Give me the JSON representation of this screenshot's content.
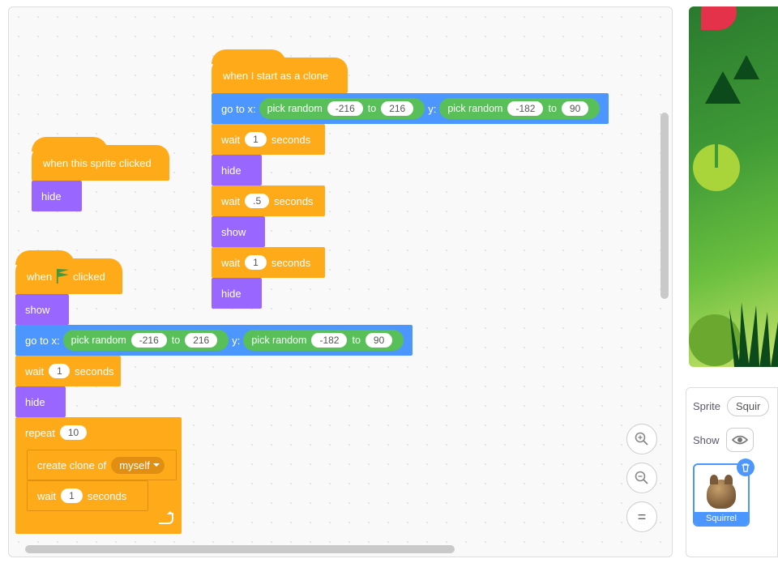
{
  "stack1": {
    "hat": "when this sprite clicked",
    "hide": "hide"
  },
  "stack2": {
    "hat_prefix": "when",
    "hat_suffix": "clicked",
    "show": "show",
    "goto_prefix": "go to x:",
    "goto_y": "y:",
    "pick": "pick random",
    "to": "to",
    "x_min": "-216",
    "x_max": "216",
    "y_min": "-182",
    "y_max": "90",
    "wait": "wait",
    "seconds": "seconds",
    "wait1_val": "1",
    "hide": "hide",
    "repeat": "repeat",
    "repeat_val": "10",
    "clone": "create clone of",
    "clone_target": "myself",
    "wait2_val": "1"
  },
  "stack3": {
    "hat": "when I start as a clone",
    "goto_prefix": "go to x:",
    "goto_y": "y:",
    "pick": "pick random",
    "to": "to",
    "x_min": "-216",
    "x_max": "216",
    "y_min": "-182",
    "y_max": "90",
    "wait": "wait",
    "seconds": "seconds",
    "w1": "1",
    "hide1": "hide",
    "w2": ".5",
    "show": "show",
    "w3": "1",
    "hide2": "hide"
  },
  "zoom": {
    "in": "+",
    "out": "−",
    "eq": "="
  },
  "panel": {
    "sprite_label": "Sprite",
    "sprite_name": "Squir",
    "show_label": "Show",
    "thumb_label": "Squirrel"
  }
}
